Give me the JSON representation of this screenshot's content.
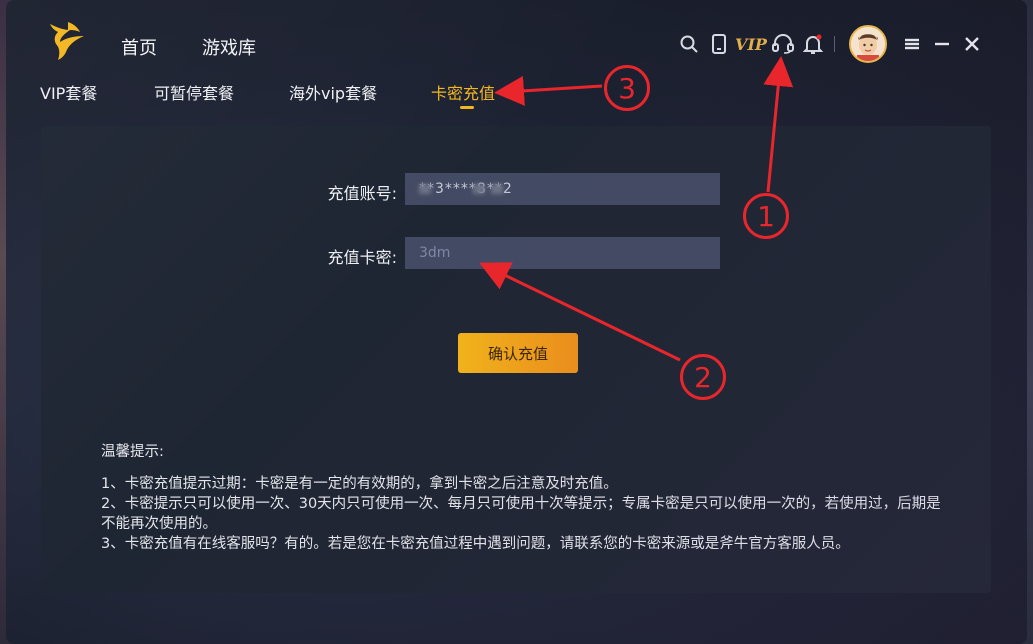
{
  "nav": {
    "home": "首页",
    "games": "游戏库"
  },
  "toolbar": {
    "vip_icon_text": "VIP"
  },
  "tabs": [
    {
      "label": "VIP套餐",
      "active": false
    },
    {
      "label": "可暂停套餐",
      "active": false
    },
    {
      "label": "海外vip套餐",
      "active": false
    },
    {
      "label": "卡密充值",
      "active": true
    }
  ],
  "form": {
    "account_label": "充值账号:",
    "account_value": "**3****8**2",
    "card_label": "充值卡密:",
    "card_placeholder": "3dm",
    "submit_label": "确认充值"
  },
  "tips": {
    "title": "温馨提示:",
    "items": [
      "1、卡密充值提示过期：卡密是有一定的有效期的，拿到卡密之后注意及时充值。",
      "2、卡密提示只可以使用一次、30天内只可使用一次、每月只可使用十次等提示；专属卡密是只可以使用一次的，若使用过，后期是不能再次使用的。",
      "3、卡密充值有在线客服吗？有的。若是您在卡密充值过程中遇到问题，请联系您的卡密来源或是斧牛官方客服人员。"
    ]
  },
  "annotations": [
    "1",
    "2",
    "3"
  ],
  "colors": {
    "accent": "#f3b620",
    "annotation": "#e8262b",
    "vip": "#e3b04a"
  }
}
